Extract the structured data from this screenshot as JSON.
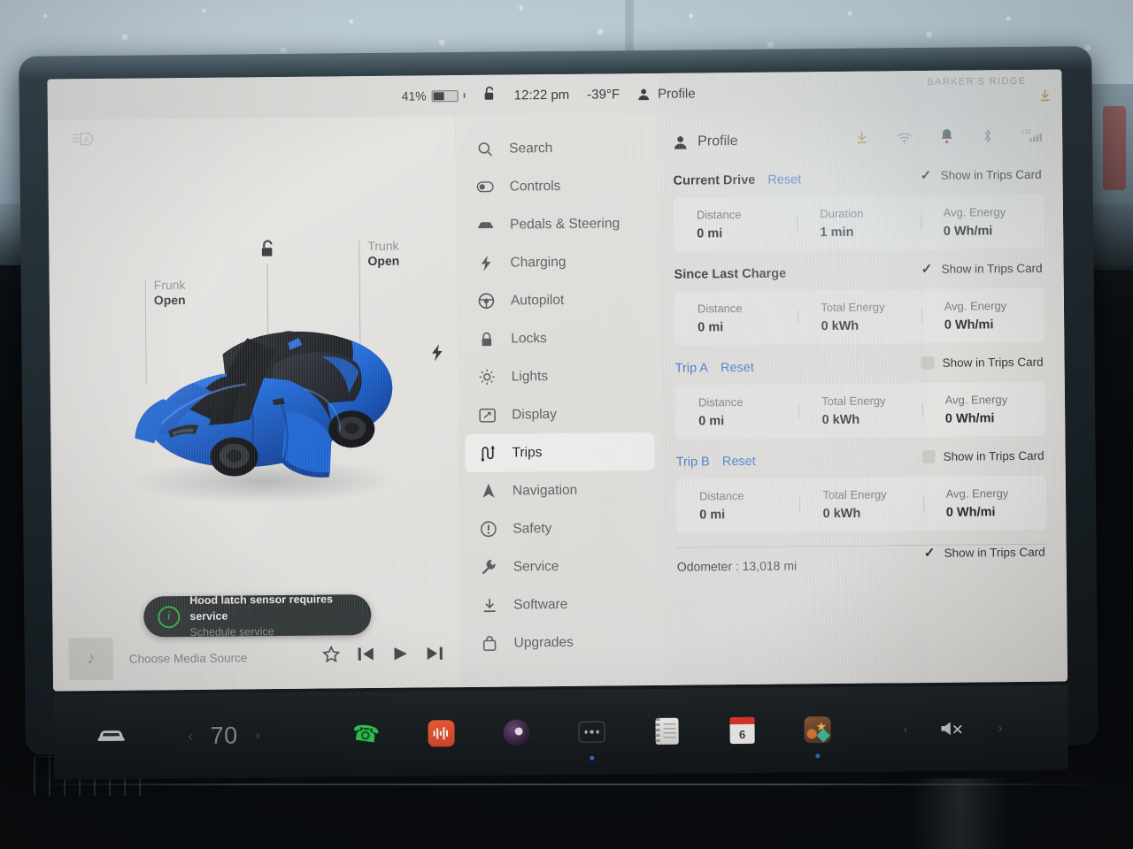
{
  "statusbar": {
    "battery_percent": "41%",
    "battery_level": 41,
    "lock_icon": "unlock-icon",
    "time": "12:22 pm",
    "temperature": "-39°F",
    "profile_label": "Profile",
    "map_label": "BARKER'S RIDGE"
  },
  "car_view": {
    "autolight_icon": "auto-headlight-icon",
    "frunk": {
      "label": "Frunk",
      "state": "Open"
    },
    "trunk": {
      "label": "Trunk",
      "state": "Open"
    },
    "unlock_icon": "unlock-icon",
    "charge_port_icon": "charge-bolt-icon",
    "toast": {
      "icon": "info-icon",
      "title": "Hood latch sensor requires service",
      "subtitle": "Schedule service"
    }
  },
  "media": {
    "art_icon": "music-note-icon",
    "source_label": "Choose Media Source",
    "favorite_icon": "star-icon",
    "prev_icon": "skip-previous-icon",
    "play_icon": "play-icon",
    "next_icon": "skip-next-icon"
  },
  "sidebar": {
    "items": [
      {
        "label": "Search",
        "icon": "search-icon",
        "active": false
      },
      {
        "label": "Controls",
        "icon": "toggle-icon",
        "active": false
      },
      {
        "label": "Pedals & Steering",
        "icon": "car-icon",
        "active": false
      },
      {
        "label": "Charging",
        "icon": "bolt-icon",
        "active": false
      },
      {
        "label": "Autopilot",
        "icon": "steering-icon",
        "active": false
      },
      {
        "label": "Locks",
        "icon": "lock-icon",
        "active": false
      },
      {
        "label": "Lights",
        "icon": "light-bulb-icon",
        "active": false
      },
      {
        "label": "Display",
        "icon": "display-icon",
        "active": false
      },
      {
        "label": "Trips",
        "icon": "trips-route-icon",
        "active": true
      },
      {
        "label": "Navigation",
        "icon": "navigation-icon",
        "active": false
      },
      {
        "label": "Safety",
        "icon": "warning-icon",
        "active": false
      },
      {
        "label": "Service",
        "icon": "wrench-icon",
        "active": false
      },
      {
        "label": "Software",
        "icon": "download-icon",
        "active": false
      },
      {
        "label": "Upgrades",
        "icon": "bag-icon",
        "active": false
      }
    ]
  },
  "content": {
    "header": {
      "icon": "profile-icon",
      "title": "Profile",
      "status_icons": [
        {
          "name": "software-download-icon",
          "style": "orange"
        },
        {
          "name": "wifi-icon",
          "style": "dim"
        },
        {
          "name": "notification-bell-icon",
          "style": "bell"
        },
        {
          "name": "bluetooth-icon",
          "style": "dim"
        },
        {
          "name": "lte-signal-icon",
          "style": "dim",
          "label": "LTE"
        }
      ]
    },
    "sections": [
      {
        "title": "Current Drive",
        "title_is_link": false,
        "reset_label": "Reset",
        "show_reset": true,
        "toggle_label": "Show in Trips Card",
        "toggle_checked": true,
        "stats": [
          {
            "key": "Distance",
            "value": "0 mi"
          },
          {
            "key": "Duration",
            "value": "1 min"
          },
          {
            "key": "Avg. Energy",
            "value": "0 Wh/mi"
          }
        ]
      },
      {
        "title": "Since Last Charge",
        "title_is_link": false,
        "reset_label": "",
        "show_reset": false,
        "toggle_label": "Show in Trips Card",
        "toggle_checked": true,
        "stats": [
          {
            "key": "Distance",
            "value": "0 mi"
          },
          {
            "key": "Total Energy",
            "value": "0 kWh"
          },
          {
            "key": "Avg. Energy",
            "value": "0 Wh/mi"
          }
        ]
      },
      {
        "title": "Trip A",
        "title_is_link": true,
        "reset_label": "Reset",
        "show_reset": true,
        "toggle_label": "Show in Trips Card",
        "toggle_checked": false,
        "stats": [
          {
            "key": "Distance",
            "value": "0 mi"
          },
          {
            "key": "Total Energy",
            "value": "0 kWh"
          },
          {
            "key": "Avg. Energy",
            "value": "0 Wh/mi"
          }
        ]
      },
      {
        "title": "Trip B",
        "title_is_link": true,
        "reset_label": "Reset",
        "show_reset": true,
        "toggle_label": "Show in Trips Card",
        "toggle_checked": false,
        "stats": [
          {
            "key": "Distance",
            "value": "0 mi"
          },
          {
            "key": "Total Energy",
            "value": "0 kWh"
          },
          {
            "key": "Avg. Energy",
            "value": "0 Wh/mi"
          }
        ]
      }
    ],
    "odometer": {
      "text": "Odometer :  13,018 mi",
      "toggle_label": "Show in Trips Card",
      "toggle_checked": true
    }
  },
  "dock": {
    "car_icon": "car-front-icon",
    "climate": {
      "decrease_icon": "chevron-left-icon",
      "temperature": "70",
      "increase_icon": "chevron-right-icon"
    },
    "apps": [
      {
        "name": "phone-app-icon",
        "dot": false
      },
      {
        "name": "media-app-icon",
        "dot": false
      },
      {
        "name": "navigation-app-icon",
        "dot": false
      },
      {
        "name": "more-apps-icon",
        "dot": true
      },
      {
        "name": "notes-app-icon",
        "dot": false
      },
      {
        "name": "calendar-app-icon",
        "dot": false,
        "day": "6"
      },
      {
        "name": "toybox-app-icon",
        "dot": true
      }
    ],
    "volume": {
      "decrease_icon": "chevron-left-icon",
      "mute_icon": "volume-mute-icon",
      "increase_icon": "chevron-right-icon"
    }
  },
  "colors": {
    "accent_blue": "#2f6fd0",
    "screen_bg": "#e8e7e4",
    "dock_bg": "#191e21",
    "car_blue": "#1763d8",
    "toast_bg": "#2f3436",
    "toast_ring": "#39b54a"
  }
}
